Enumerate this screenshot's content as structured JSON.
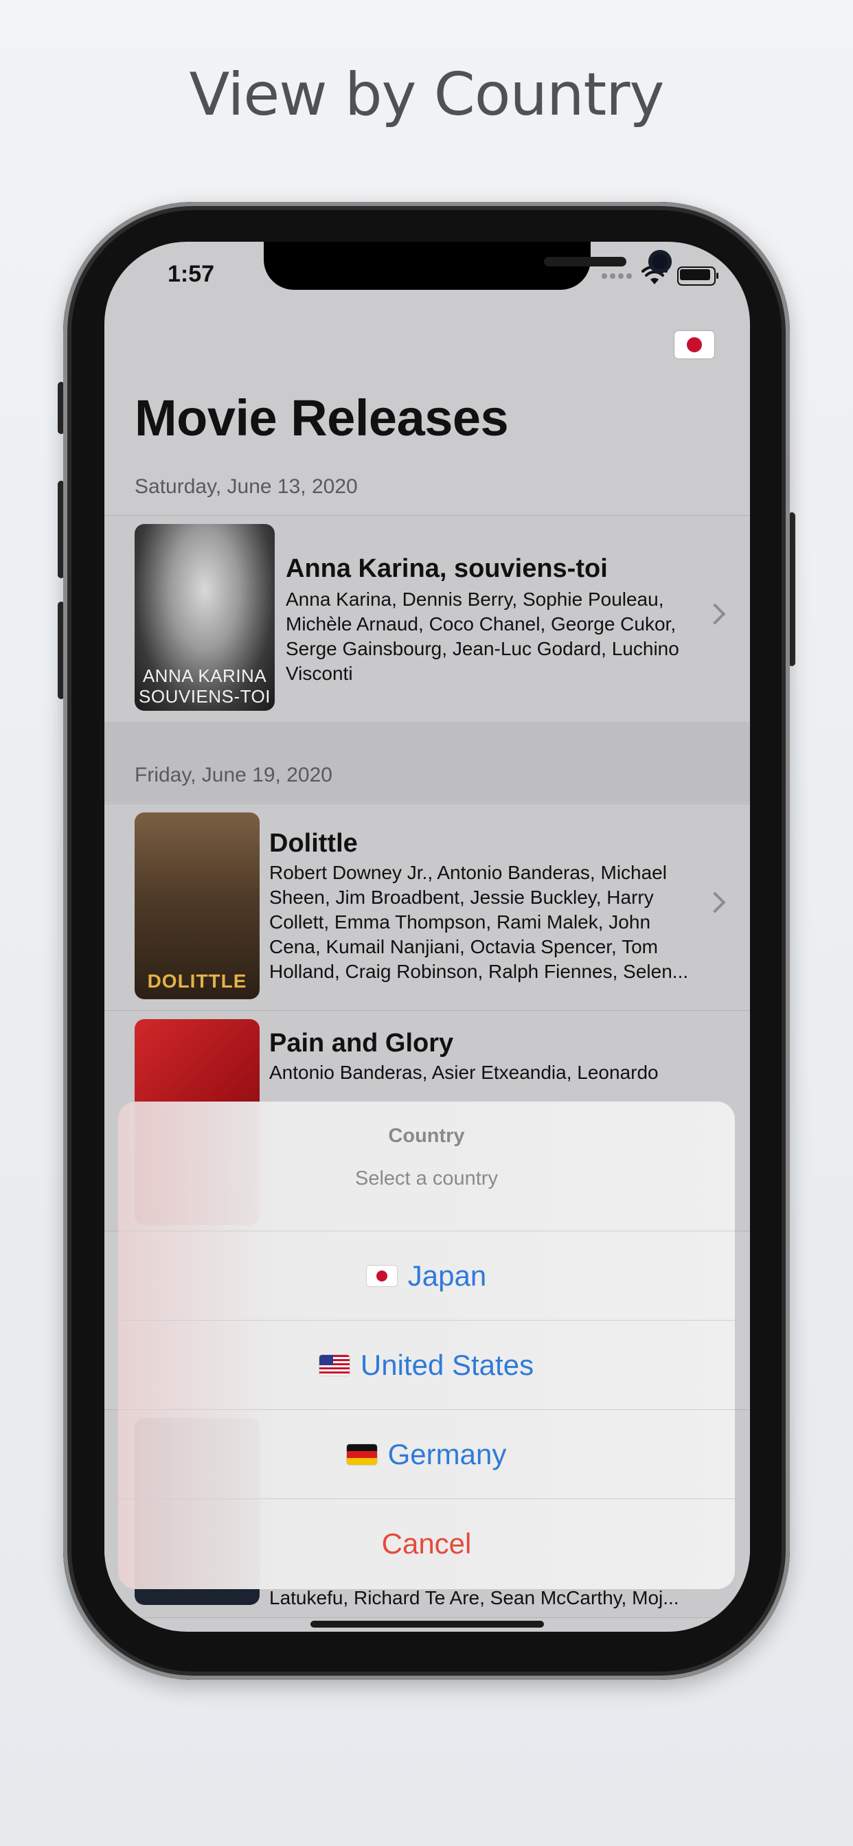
{
  "headline": "View by Country",
  "status_bar": {
    "time": "1:57"
  },
  "nav": {
    "title": "Movie Releases",
    "country_flag_icon": "japan-flag-icon"
  },
  "sections": [
    {
      "date": "Saturday, June 13, 2020",
      "movies": [
        {
          "title": "Anna Karina, souviens-toi",
          "cast_lines": [
            "Anna Karina, Dennis Berry, Sophie Pouleau,",
            "Michèle Arnaud, Coco Chanel, George Cukor,",
            "Serge Gainsbourg, Jean-Luc Godard, Luchino",
            "Visconti"
          ],
          "poster_text": [
            "ANNA KARINA",
            "SOUVIENS-TOI"
          ]
        }
      ]
    },
    {
      "date": "Friday, June 19, 2020",
      "movies": [
        {
          "title": "Dolittle",
          "cast_lines": [
            "Robert Downey Jr., Antonio Banderas, Michael",
            "Sheen, Jim Broadbent, Jessie Buckley, Harry",
            "Collett, Emma Thompson, Rami Malek, John",
            "Cena, Kumail Nanjiani, Octavia Spencer, Tom",
            "Holland, Craig Robinson, Ralph Fiennes, Selen..."
          ],
          "poster_text": [
            "DOLITTLE"
          ]
        },
        {
          "title": "Pain and Glory",
          "cast_lines": [
            "Antonio Banderas, Asier Etxeandia, Leonardo"
          ]
        },
        {
          "cast_lines": [
            "Latukefu, Richard Te Are, Sean McCarthy, Moj..."
          ]
        }
      ]
    }
  ],
  "action_sheet": {
    "title": "Country",
    "message": "Select a country",
    "options": [
      {
        "label": "Japan",
        "flag_icon": "japan-flag-icon"
      },
      {
        "label": "United States",
        "flag_icon": "us-flag-icon"
      },
      {
        "label": "Germany",
        "flag_icon": "germany-flag-icon"
      }
    ],
    "cancel_label": "Cancel"
  },
  "colors": {
    "action_blue": "#2f7ad9",
    "cancel_red": "#e64a3b"
  }
}
